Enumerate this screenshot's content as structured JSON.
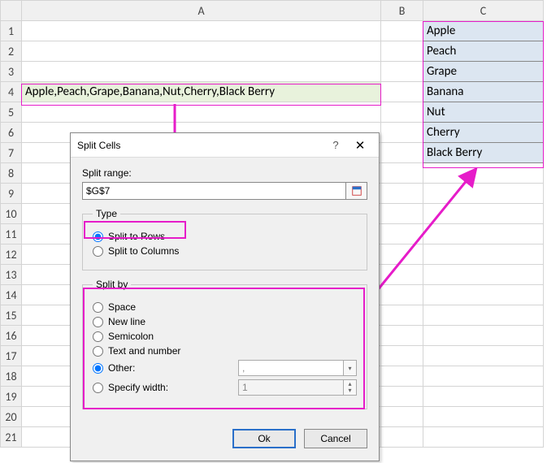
{
  "columns": {
    "a": "A",
    "b": "B",
    "c": "C"
  },
  "rows": [
    "1",
    "2",
    "3",
    "4",
    "5",
    "6",
    "7",
    "8",
    "9",
    "10",
    "11",
    "12",
    "13",
    "14",
    "15",
    "16",
    "17",
    "18",
    "19",
    "20",
    "21"
  ],
  "source_cell": "Apple,Peach,Grape,Banana,Nut,Cherry,Black Berry",
  "result_cells": [
    "Apple",
    "Peach",
    "Grape",
    "Banana",
    "Nut",
    "Cherry",
    "Black Berry"
  ],
  "dialog": {
    "title": "Split Cells",
    "help": "?",
    "close": "✕",
    "split_range_label": "Split range:",
    "range_value": "$G$7",
    "type_legend": "Type",
    "type_rows": "Split to Rows",
    "type_cols": "Split to Columns",
    "splitby_legend": "Split by",
    "by_space": "Space",
    "by_newline": "New line",
    "by_semicolon": "Semicolon",
    "by_textnum": "Text and number",
    "by_other": "Other:",
    "other_value": ",",
    "by_width": "Specify width:",
    "width_value": "1",
    "ok": "Ok",
    "cancel": "Cancel"
  }
}
